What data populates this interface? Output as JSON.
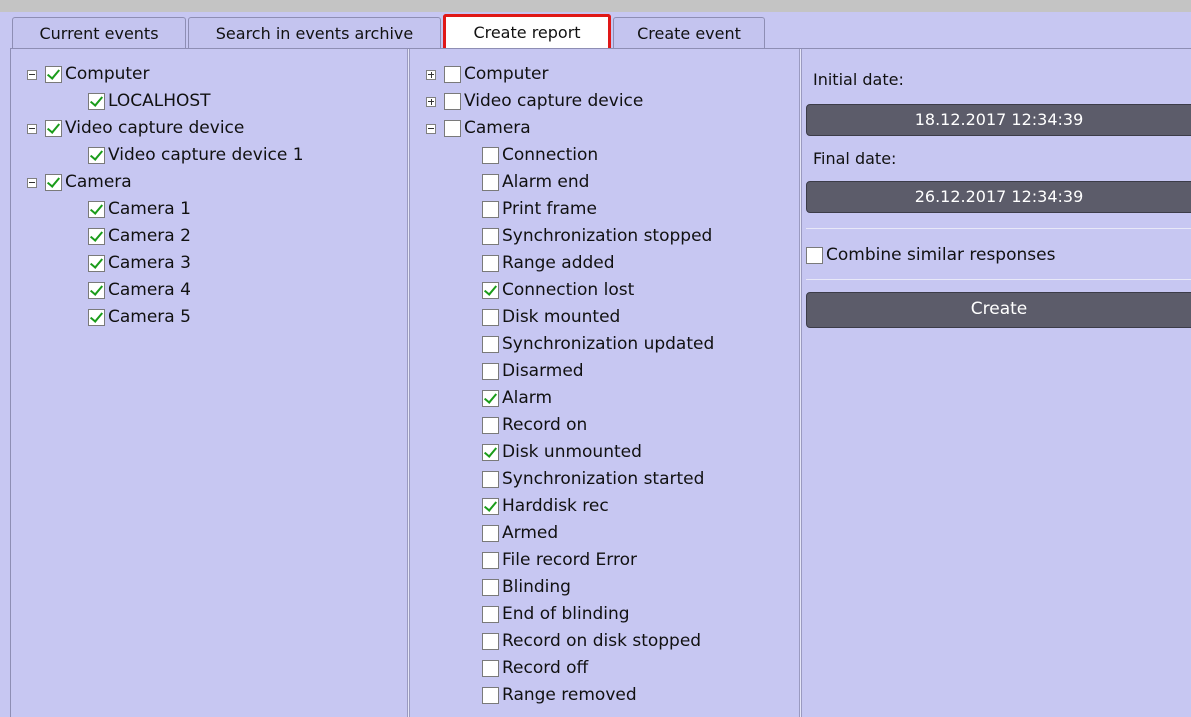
{
  "tabs": [
    {
      "label": "Current events",
      "active": false
    },
    {
      "label": "Search in events archive",
      "active": false
    },
    {
      "label": "Create report",
      "active": true
    },
    {
      "label": "Create event",
      "active": false
    }
  ],
  "left_tree": [
    {
      "label": "Computer",
      "level": 0,
      "expander": "minus",
      "checked": true
    },
    {
      "label": "LOCALHOST",
      "level": 1,
      "checked": true
    },
    {
      "label": "Video capture device",
      "level": 0,
      "expander": "minus",
      "checked": true
    },
    {
      "label": "Video capture device 1",
      "level": 1,
      "checked": true
    },
    {
      "label": "Camera",
      "level": 0,
      "expander": "minus",
      "checked": true
    },
    {
      "label": "Camera 1",
      "level": 1,
      "checked": true
    },
    {
      "label": "Camera 2",
      "level": 1,
      "checked": true
    },
    {
      "label": "Camera 3",
      "level": 1,
      "checked": true
    },
    {
      "label": "Camera 4",
      "level": 1,
      "checked": true
    },
    {
      "label": "Camera 5",
      "level": 1,
      "checked": true
    }
  ],
  "middle_tree": [
    {
      "label": "Computer",
      "level": 0,
      "expander": "plus",
      "checked": false
    },
    {
      "label": "Video capture device",
      "level": 0,
      "expander": "plus",
      "checked": false
    },
    {
      "label": "Camera",
      "level": 0,
      "expander": "minus",
      "checked": false
    },
    {
      "label": "Connection",
      "level": 1,
      "checked": false
    },
    {
      "label": "Alarm end",
      "level": 1,
      "checked": false
    },
    {
      "label": "Print frame",
      "level": 1,
      "checked": false
    },
    {
      "label": "Synchronization stopped",
      "level": 1,
      "checked": false
    },
    {
      "label": "Range added",
      "level": 1,
      "checked": false
    },
    {
      "label": "Connection lost",
      "level": 1,
      "checked": true
    },
    {
      "label": "Disk mounted",
      "level": 1,
      "checked": false
    },
    {
      "label": "Synchronization updated",
      "level": 1,
      "checked": false
    },
    {
      "label": "Disarmed",
      "level": 1,
      "checked": false
    },
    {
      "label": "Alarm",
      "level": 1,
      "checked": true
    },
    {
      "label": "Record on",
      "level": 1,
      "checked": false
    },
    {
      "label": "Disk unmounted",
      "level": 1,
      "checked": true
    },
    {
      "label": "Synchronization started",
      "level": 1,
      "checked": false
    },
    {
      "label": "Harddisk rec",
      "level": 1,
      "checked": true
    },
    {
      "label": "Armed",
      "level": 1,
      "checked": false
    },
    {
      "label": "File record Error",
      "level": 1,
      "checked": false
    },
    {
      "label": "Blinding",
      "level": 1,
      "checked": false
    },
    {
      "label": "End of blinding",
      "level": 1,
      "checked": false
    },
    {
      "label": "Record on disk stopped",
      "level": 1,
      "checked": false
    },
    {
      "label": "Record off",
      "level": 1,
      "checked": false
    },
    {
      "label": "Range removed",
      "level": 1,
      "checked": false
    }
  ],
  "report": {
    "initial_label": "Initial date:",
    "initial_value": "18.12.2017 12:34:39",
    "final_label": "Final date:",
    "final_value": "26.12.2017 12:34:39",
    "combine_label": "Combine similar responses",
    "combine_checked": false,
    "create_label": "Create"
  },
  "colors": {
    "background": "#c7c7f2",
    "button": "#5c5c6a",
    "active_tab_border": "#e01818",
    "check": "#1a9c1a"
  }
}
